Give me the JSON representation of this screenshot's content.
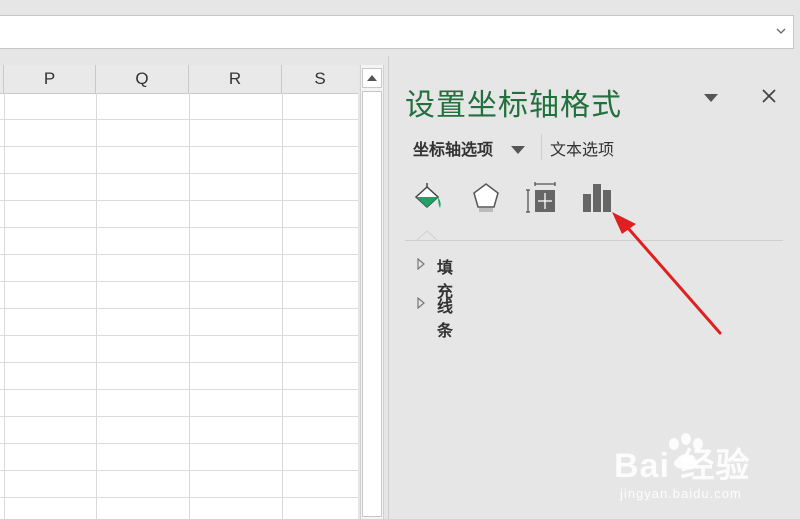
{
  "formula_bar": {
    "value": ""
  },
  "sheet": {
    "columns": [
      "P",
      "Q",
      "R",
      "S"
    ]
  },
  "pane": {
    "title": "设置坐标轴格式",
    "tabs": {
      "axis_options": "坐标轴选项",
      "text_options": "文本选项"
    },
    "icons": [
      "fill-line-icon",
      "effects-pentagon-icon",
      "size-properties-icon",
      "axis-options-chart-icon"
    ],
    "sections": [
      {
        "label": "填充"
      },
      {
        "label": "线条"
      }
    ]
  },
  "annotation": {
    "arrow_color": "#e02020"
  },
  "watermark": {
    "brand": "Bai 经验",
    "url": "jingyan.baidu.com"
  },
  "colors": {
    "title_green": "#21703e",
    "fill_icon_green": "#21a366"
  }
}
